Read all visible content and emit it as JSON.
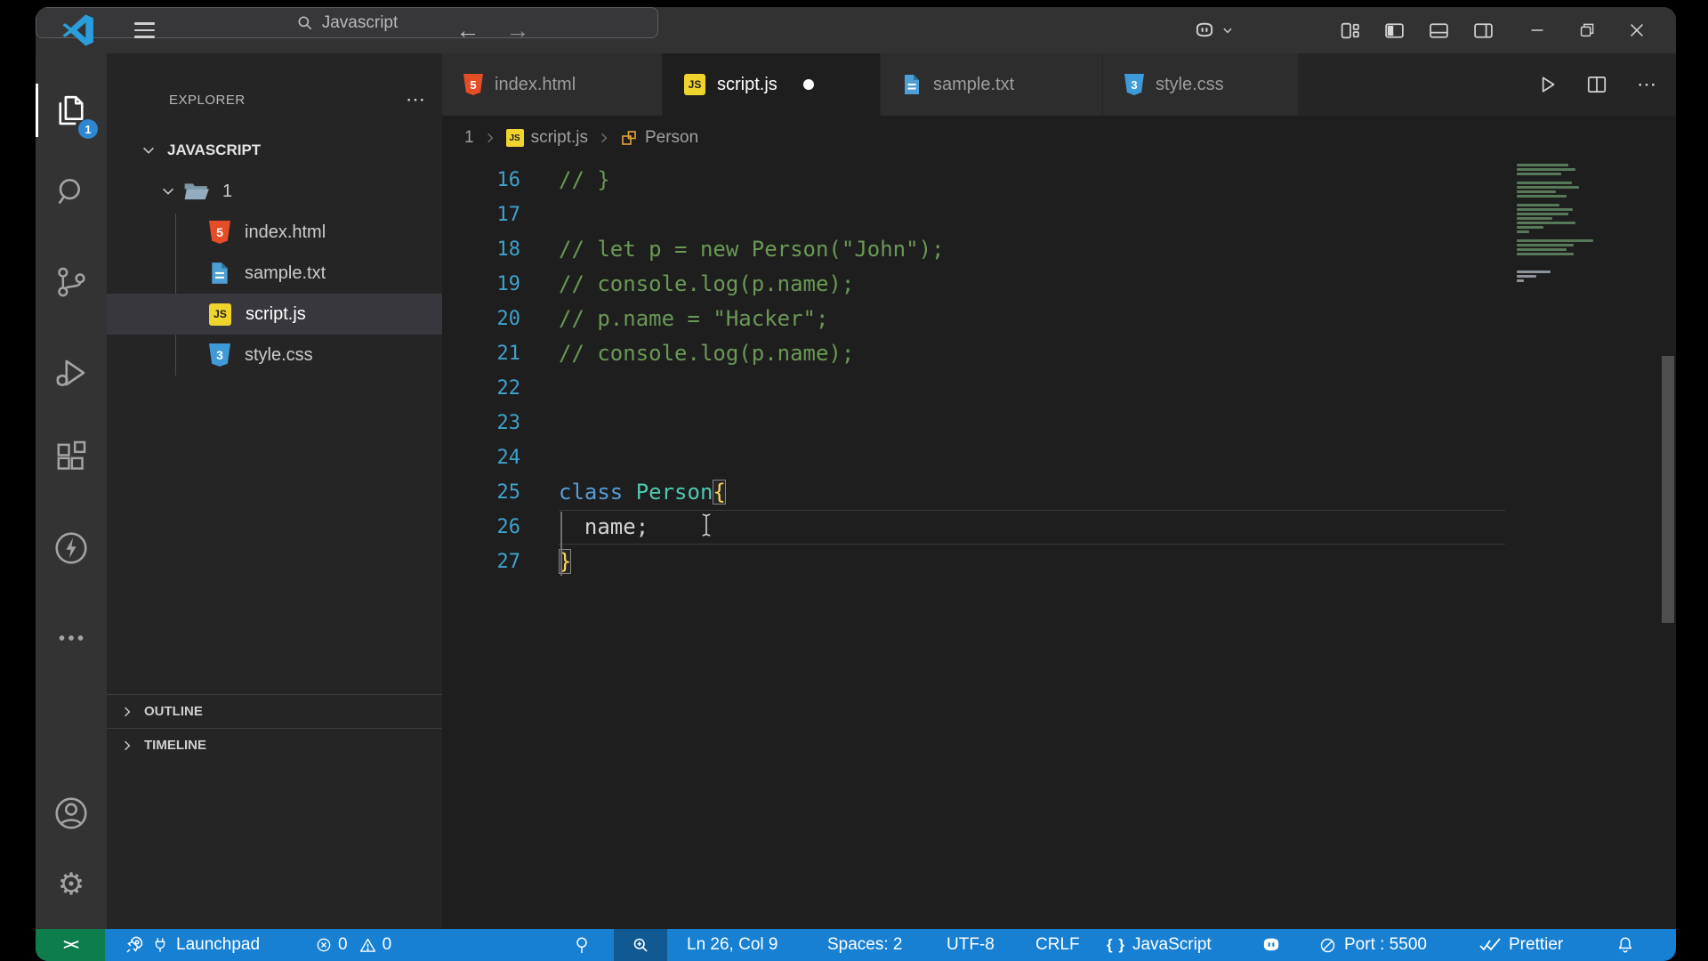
{
  "titlebar": {
    "search_value": "Javascript"
  },
  "activity_bar": {
    "badge": "1",
    "items": [
      {
        "name": "explorer",
        "active": true
      },
      {
        "name": "search",
        "active": false
      },
      {
        "name": "source-control",
        "active": false
      },
      {
        "name": "run-and-debug",
        "active": false
      },
      {
        "name": "extensions",
        "active": false
      },
      {
        "name": "thunder-client",
        "active": false
      },
      {
        "name": "more-views",
        "active": false
      },
      {
        "name": "accounts",
        "active": false
      },
      {
        "name": "settings",
        "active": false
      }
    ]
  },
  "sidebar": {
    "header": "EXPLORER",
    "more_label": "⋯",
    "workspace": "JAVASCRIPT",
    "folder": "1",
    "files": [
      {
        "name": "index.html",
        "type": "html",
        "selected": false
      },
      {
        "name": "sample.txt",
        "type": "txt",
        "selected": false
      },
      {
        "name": "script.js",
        "type": "js",
        "selected": true
      },
      {
        "name": "style.css",
        "type": "css",
        "selected": false
      }
    ],
    "sections": [
      {
        "label": "OUTLINE"
      },
      {
        "label": "TIMELINE"
      }
    ]
  },
  "editor": {
    "tabs": [
      {
        "label": "index.html",
        "type": "html",
        "active": false,
        "dirty": false
      },
      {
        "label": "script.js",
        "type": "js",
        "active": true,
        "dirty": true
      },
      {
        "label": "sample.txt",
        "type": "txt",
        "active": false,
        "dirty": false
      },
      {
        "label": "style.css",
        "type": "css",
        "active": false,
        "dirty": false
      }
    ],
    "breadcrumb": [
      "1",
      "script.js",
      "Person"
    ],
    "code": {
      "language": "javascript",
      "lines": [
        {
          "n": 16,
          "tokens": [
            {
              "t": "// }",
              "c": "comment"
            }
          ]
        },
        {
          "n": 17,
          "tokens": []
        },
        {
          "n": 18,
          "tokens": [
            {
              "t": "// let p = new Person(\"John\");",
              "c": "comment"
            }
          ]
        },
        {
          "n": 19,
          "tokens": [
            {
              "t": "// console.log(p.name);",
              "c": "comment"
            }
          ]
        },
        {
          "n": 20,
          "tokens": [
            {
              "t": "// p.name = \"Hacker\";",
              "c": "comment"
            }
          ]
        },
        {
          "n": 21,
          "tokens": [
            {
              "t": "// console.log(p.name);",
              "c": "comment"
            }
          ]
        },
        {
          "n": 22,
          "tokens": []
        },
        {
          "n": 23,
          "tokens": []
        },
        {
          "n": 24,
          "tokens": []
        },
        {
          "n": 25,
          "tokens": [
            {
              "t": "class",
              "c": "keyword"
            },
            {
              "t": " ",
              "c": "plain"
            },
            {
              "t": "Person",
              "c": "type"
            },
            {
              "t": "{",
              "c": "brace-match"
            }
          ]
        },
        {
          "n": 26,
          "tokens": [
            {
              "t": "  name;",
              "c": "plain"
            }
          ],
          "current": true
        },
        {
          "n": 27,
          "tokens": [
            {
              "t": "}",
              "c": "brace-match"
            }
          ]
        }
      ]
    },
    "minimap": [
      [
        58,
        "g"
      ],
      [
        66,
        "g"
      ],
      [
        50,
        "g"
      ],
      [
        0,
        "g"
      ],
      [
        62,
        "g"
      ],
      [
        70,
        "g"
      ],
      [
        44,
        "g"
      ],
      [
        56,
        "g"
      ],
      [
        0,
        "g"
      ],
      [
        48,
        "g"
      ],
      [
        63,
        "g"
      ],
      [
        58,
        "g"
      ],
      [
        40,
        "g"
      ],
      [
        66,
        "g"
      ],
      [
        30,
        "g"
      ],
      [
        14,
        "g"
      ],
      [
        0,
        "g"
      ],
      [
        86,
        "g"
      ],
      [
        64,
        "g"
      ],
      [
        56,
        "g"
      ],
      [
        64,
        "g"
      ],
      [
        0,
        "g"
      ],
      [
        0,
        "g"
      ],
      [
        0,
        "g"
      ],
      [
        38,
        "d"
      ],
      [
        22,
        "d"
      ],
      [
        8,
        "d"
      ]
    ]
  },
  "status_bar": {
    "remote_indicator": "><",
    "launchpad": "Launchpad",
    "errors": "0",
    "warnings": "0",
    "line_col": "Ln 26, Col 9",
    "indentation": "Spaces: 2",
    "encoding": "UTF-8",
    "eol": "CRLF",
    "braces": "{ }",
    "language": "JavaScript",
    "port": "Port : 5500",
    "formatter": "Prettier"
  },
  "icons": {
    "vscode-logo": "blue ribbon mark",
    "menu": "hamburger",
    "search": "magnifier",
    "copilot": "copilot goggles",
    "class-symbol": "orange class glyph",
    "remote": "><",
    "settings": "⚙"
  },
  "colors": {
    "statusbar": "#1780d2",
    "remote_green": "#0d7d4d",
    "badge_blue": "#2d86cf",
    "comment": "#6a9955",
    "keyword": "#569cd6",
    "type": "#4ec9b0",
    "brace": "#ffd65e",
    "line_number": "#3fa2cc"
  }
}
